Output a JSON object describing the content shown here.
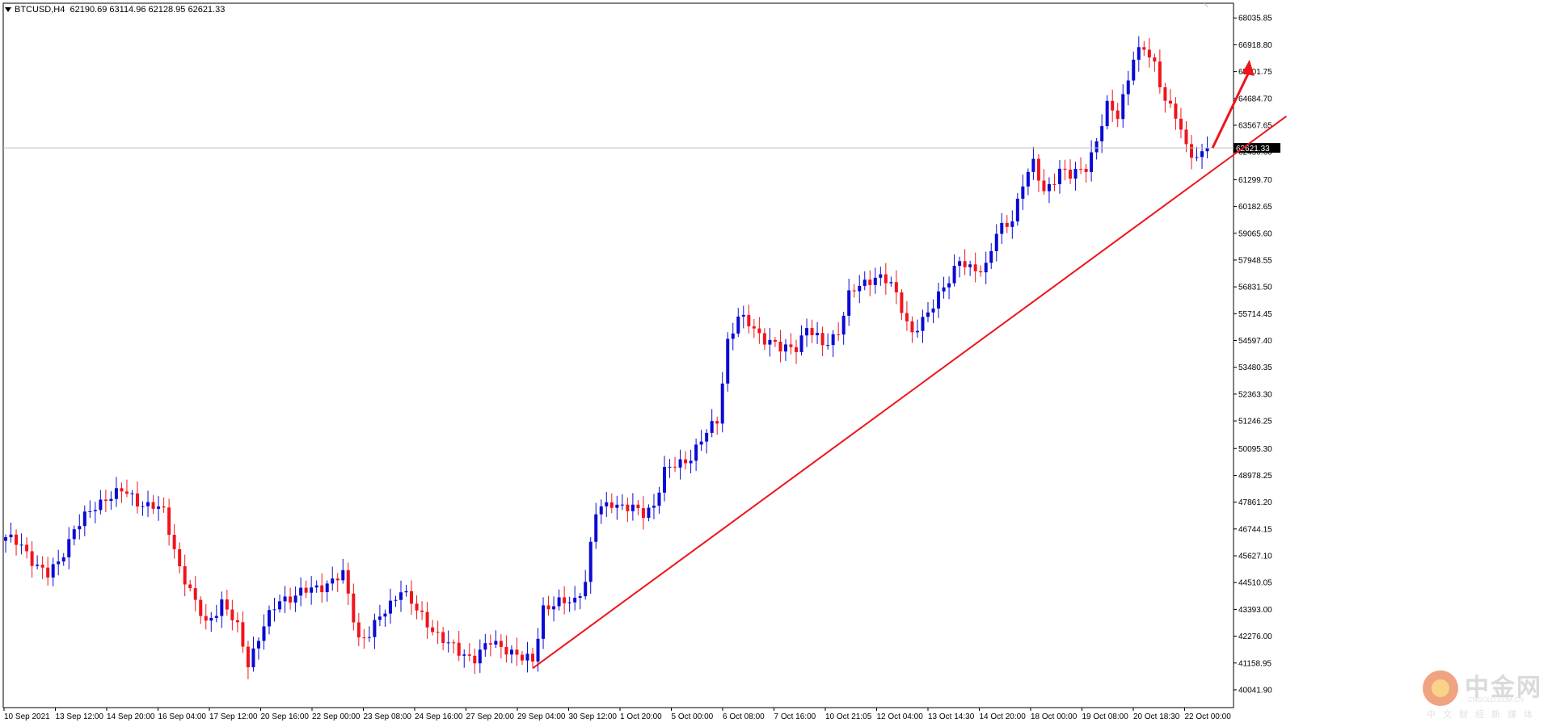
{
  "header": {
    "symbol": "BTCUSD,H4",
    "ohlc": "62190.69 63114.96 62128.95 62621.33"
  },
  "chart_data": {
    "type": "candlestick",
    "symbol": "BTCUSD",
    "timeframe": "H4",
    "ylim": [
      39300,
      68650
    ],
    "price_ticks": [
      "68035.85",
      "66918.80",
      "65801.75",
      "64684.70",
      "63567.65",
      "62450.60",
      "61299.70",
      "60182.65",
      "59065.60",
      "57948.55",
      "56831.50",
      "55714.45",
      "54597.40",
      "53480.35",
      "52363.30",
      "51246.25",
      "50095.30",
      "48978.25",
      "47861.20",
      "46744.15",
      "45627.10",
      "44510.05",
      "43393.00",
      "42276.00",
      "41158.95",
      "40041.90"
    ],
    "current_price": "62621.33",
    "x_labels": [
      "10 Sep 2021",
      "13 Sep 12:00",
      "14 Sep 20:00",
      "16 Sep 04:00",
      "17 Sep 12:00",
      "20 Sep 16:00",
      "22 Sep 00:00",
      "23 Sep 08:00",
      "24 Sep 16:00",
      "27 Sep 20:00",
      "29 Sep 04:00",
      "30 Sep 12:00",
      "1 Oct 20:00",
      "5 Oct 00:00",
      "6 Oct 08:00",
      "7 Oct 16:00",
      "10 Oct 21:05",
      "12 Oct 04:00",
      "13 Oct 14:30",
      "14 Oct 20:00",
      "18 Oct 00:00",
      "19 Oct 08:00",
      "20 Oct 18:30",
      "22 Oct 00:00"
    ],
    "anchors": [
      [
        0,
        46400
      ],
      [
        3,
        46000
      ],
      [
        5,
        45500
      ],
      [
        8,
        44800
      ],
      [
        10,
        45300
      ],
      [
        13,
        46800
      ],
      [
        16,
        47400
      ],
      [
        19,
        48100
      ],
      [
        22,
        48300
      ],
      [
        25,
        47900
      ],
      [
        28,
        47700
      ],
      [
        30,
        47400
      ],
      [
        33,
        45200
      ],
      [
        36,
        43600
      ],
      [
        38,
        42800
      ],
      [
        41,
        43700
      ],
      [
        44,
        42600
      ],
      [
        46,
        41200
      ],
      [
        49,
        42700
      ],
      [
        52,
        43800
      ],
      [
        55,
        44000
      ],
      [
        58,
        44200
      ],
      [
        61,
        44500
      ],
      [
        64,
        44800
      ],
      [
        67,
        42200
      ],
      [
        69,
        42400
      ],
      [
        72,
        43300
      ],
      [
        75,
        44300
      ],
      [
        78,
        43300
      ],
      [
        81,
        42600
      ],
      [
        84,
        41900
      ],
      [
        86,
        41600
      ],
      [
        89,
        41400
      ],
      [
        92,
        42000
      ],
      [
        95,
        41800
      ],
      [
        98,
        41300
      ],
      [
        100,
        41250
      ],
      [
        102,
        43500
      ],
      [
        105,
        43600
      ],
      [
        108,
        43800
      ],
      [
        110,
        44600
      ],
      [
        112,
        47400
      ],
      [
        115,
        47900
      ],
      [
        118,
        47600
      ],
      [
        121,
        47400
      ],
      [
        123,
        47800
      ],
      [
        125,
        49100
      ],
      [
        128,
        49500
      ],
      [
        130,
        49800
      ],
      [
        133,
        50700
      ],
      [
        135,
        51300
      ],
      [
        137,
        54600
      ],
      [
        139,
        55500
      ],
      [
        141,
        55300
      ],
      [
        144,
        54700
      ],
      [
        147,
        54200
      ],
      [
        150,
        54400
      ],
      [
        152,
        55100
      ],
      [
        155,
        54400
      ],
      [
        158,
        55000
      ],
      [
        160,
        56400
      ],
      [
        162,
        56900
      ],
      [
        165,
        57300
      ],
      [
        168,
        56900
      ],
      [
        170,
        56000
      ],
      [
        172,
        54900
      ],
      [
        175,
        55600
      ],
      [
        177,
        56600
      ],
      [
        179,
        57200
      ],
      [
        181,
        57800
      ],
      [
        183,
        57600
      ],
      [
        186,
        57700
      ],
      [
        188,
        59000
      ],
      [
        191,
        59700
      ],
      [
        193,
        61200
      ],
      [
        195,
        61900
      ],
      [
        197,
        60800
      ],
      [
        200,
        61700
      ],
      [
        202,
        61400
      ],
      [
        205,
        61900
      ],
      [
        207,
        62900
      ],
      [
        209,
        64300
      ],
      [
        211,
        64000
      ],
      [
        214,
        66400
      ],
      [
        216,
        66700
      ],
      [
        218,
        66100
      ],
      [
        220,
        64700
      ],
      [
        222,
        63900
      ],
      [
        224,
        62600
      ],
      [
        226,
        62300
      ],
      [
        228,
        62620
      ]
    ],
    "trendline": {
      "from": [
        100,
        40940
      ],
      "to": [
        243,
        63940
      ]
    },
    "arrow": {
      "from": [
        229,
        62620
      ],
      "to": [
        236,
        66300
      ]
    }
  },
  "colors": {
    "bull": "#0a0ad4",
    "bear": "#f0141c",
    "trend": "#f0141c",
    "arrow": "#f0141c",
    "grid_line": "#c0c0c0",
    "frame": "#000000",
    "price_label_bg": "#000000",
    "price_label_fg": "#ffffff"
  },
  "watermark": {
    "brand": "中金网",
    "tagline": "中文财经新媒体",
    "domain": "CNGOLD.COM.CN"
  }
}
